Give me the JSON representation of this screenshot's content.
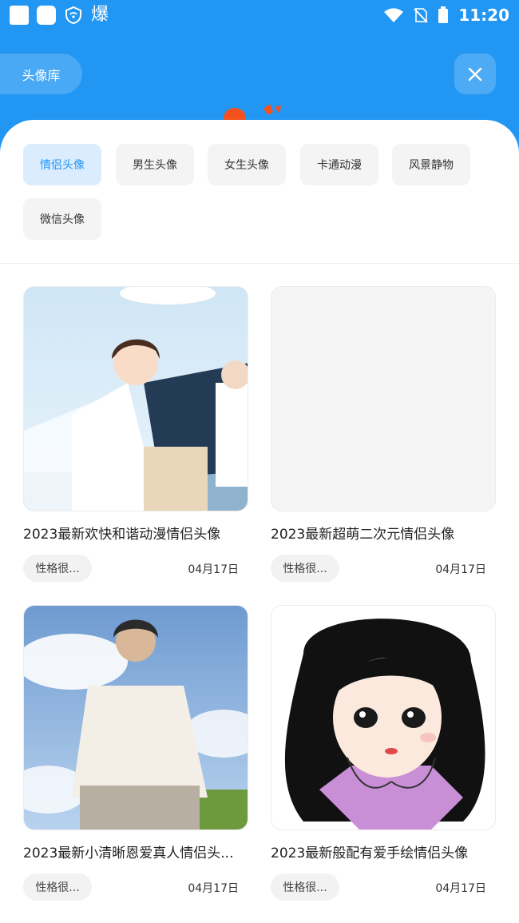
{
  "status_bar": {
    "time": "11:20",
    "app_glyph": "爆"
  },
  "header": {
    "library_button": "头像库",
    "close_icon": "close-icon"
  },
  "categories": [
    {
      "label": "情侣头像",
      "active": true
    },
    {
      "label": "男生头像",
      "active": false
    },
    {
      "label": "女生头像",
      "active": false
    },
    {
      "label": "卡通动漫",
      "active": false
    },
    {
      "label": "风景静物",
      "active": false
    },
    {
      "label": "微信头像",
      "active": false
    }
  ],
  "cards": [
    {
      "title": "2023最新欢快和谐动漫情侣头像",
      "tag": "性格很...",
      "date": "04月17日"
    },
    {
      "title": "2023最新超萌二次元情侣头像",
      "tag": "性格很...",
      "date": "04月17日"
    },
    {
      "title": "2023最新小清晰恩爱真人情侣头...",
      "tag": "性格很...",
      "date": "04月17日"
    },
    {
      "title": "2023最新般配有爱手绘情侣头像",
      "tag": "性格很...",
      "date": "04月17日"
    }
  ],
  "colors": {
    "accent": "#2196f3",
    "chip_active_bg": "#dcecff",
    "chip_bg": "#f4f4f4"
  }
}
